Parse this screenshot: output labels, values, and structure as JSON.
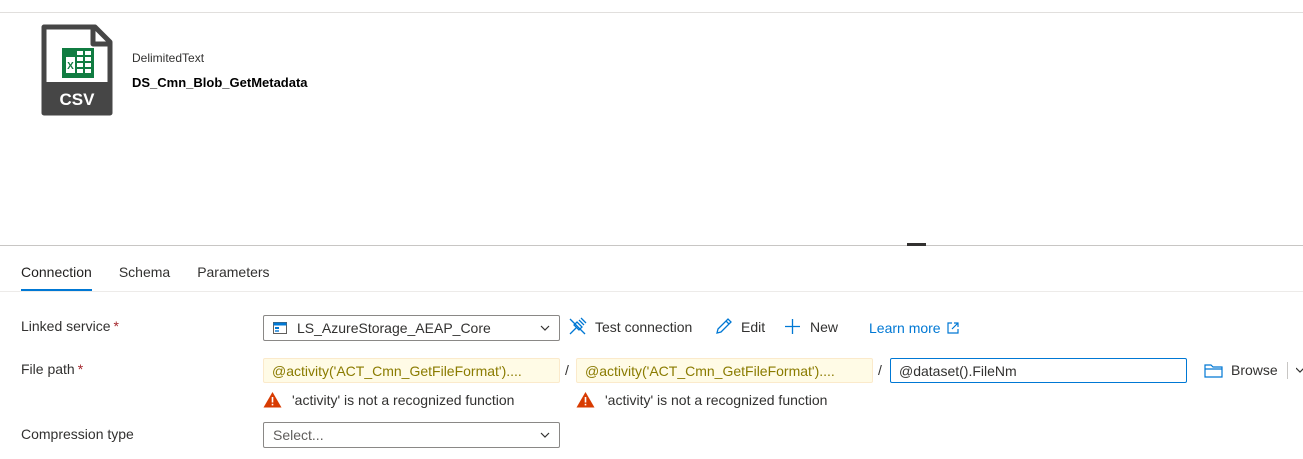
{
  "dataset": {
    "icon": "csv-file-icon",
    "icon_text": "CSV",
    "type": "DelimitedText",
    "name": "DS_Cmn_Blob_GetMetadata"
  },
  "tabs": [
    {
      "label": "Connection",
      "active": true
    },
    {
      "label": "Schema",
      "active": false
    },
    {
      "label": "Parameters",
      "active": false
    }
  ],
  "connection": {
    "linked_service": {
      "label": "Linked service",
      "required_mark": "*",
      "value": "LS_AzureStorage_AEAP_Core",
      "icon": "storage-account-icon"
    },
    "actions": {
      "test_connection": "Test connection",
      "edit": "Edit",
      "new": "New",
      "learn_more": "Learn more"
    },
    "file_path": {
      "label": "File path",
      "required_mark": "*",
      "container": "@activity('ACT_Cmn_GetFileFormat')....",
      "directory": "@activity('ACT_Cmn_GetFileFormat')....",
      "file": "@dataset().FileNm",
      "separator": "/",
      "warning_1": "'activity' is not a recognized function",
      "warning_2": "'activity' is not a recognized function",
      "browse": "Browse"
    },
    "compression": {
      "label": "Compression type",
      "placeholder": "Select..."
    }
  },
  "colors": {
    "accent": "#0078d4",
    "required": "#a4262c",
    "warning": "#d83b01",
    "expression_bg": "#fffbe6",
    "excel_green": "#107c41"
  }
}
